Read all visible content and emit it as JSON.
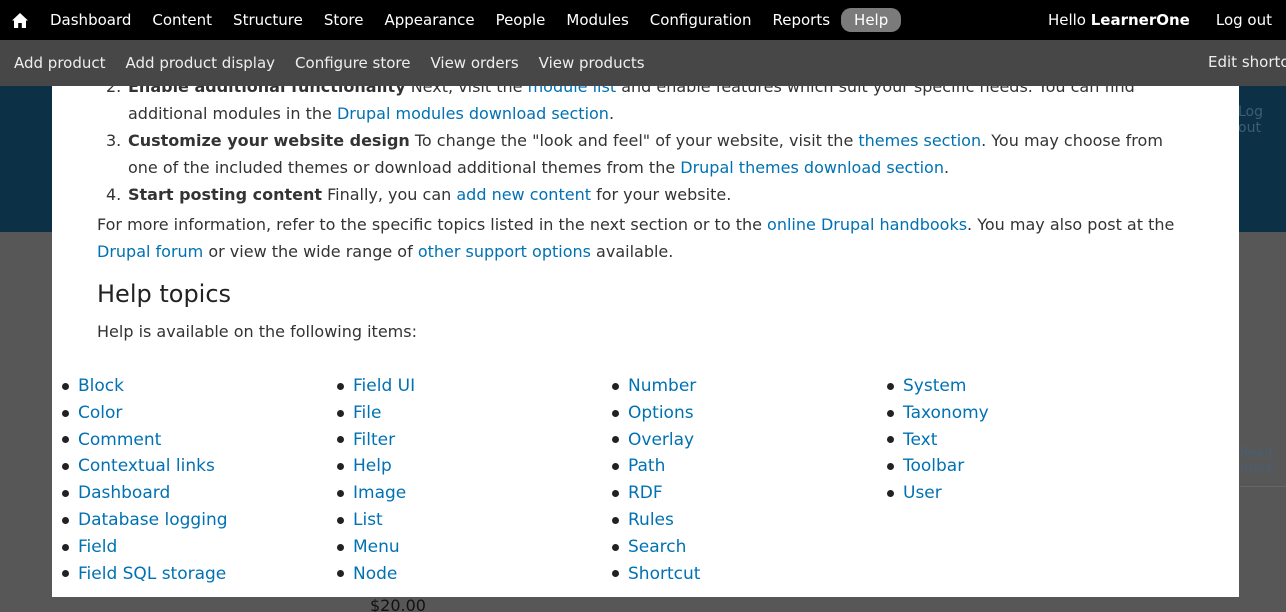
{
  "toolbar": {
    "home_label": "Home",
    "nav": [
      "Dashboard",
      "Content",
      "Structure",
      "Store",
      "Appearance",
      "People",
      "Modules",
      "Configuration",
      "Reports",
      "Help"
    ],
    "active": "Help",
    "hello_prefix": "Hello ",
    "username": "LearnerOne",
    "logout": "Log out"
  },
  "shortcuts": {
    "items": [
      "Add product",
      "Add product display",
      "Configure store",
      "View orders",
      "View products"
    ],
    "edit": "Edit shortcuts"
  },
  "background": {
    "logout": "Log out",
    "read_more": "Read more",
    "price": "$20.00"
  },
  "help": {
    "step2": {
      "num": "2.",
      "bold": "Enable additional functionality",
      "t1": " Next, visit the ",
      "l1": "module list",
      "t2": " and enable features which suit your specific needs. You can find additional modules in the ",
      "l2": "Drupal modules download section",
      "t3": "."
    },
    "step3": {
      "num": "3.",
      "bold": "Customize your website design",
      "t1": " To change the \"look and feel\" of your website, visit the ",
      "l1": "themes section",
      "t2": ". You may choose from one of the included themes or download additional themes from the ",
      "l2": "Drupal themes download section",
      "t3": "."
    },
    "step4": {
      "num": "4.",
      "bold": "Start posting content",
      "t1": " Finally, you can ",
      "l1": "add new content",
      "t2": " for your website."
    },
    "more": {
      "t1": "For more information, refer to the specific topics listed in the next section or to the ",
      "l1": "online Drupal handbooks",
      "t2": ". You may also post at the ",
      "l2": "Drupal forum",
      "t3": " or view the wide range of ",
      "l3": "other support options",
      "t4": " available."
    },
    "topics_title": "Help topics",
    "topics_intro": "Help is available on the following items:",
    "columns": [
      [
        "Block",
        "Color",
        "Comment",
        "Contextual links",
        "Dashboard",
        "Database logging",
        "Field",
        "Field SQL storage"
      ],
      [
        "Field UI",
        "File",
        "Filter",
        "Help",
        "Image",
        "List",
        "Menu",
        "Node"
      ],
      [
        "Number",
        "Options",
        "Overlay",
        "Path",
        "RDF",
        "Rules",
        "Search",
        "Shortcut"
      ],
      [
        "System",
        "Taxonomy",
        "Text",
        "Toolbar",
        "User"
      ]
    ]
  }
}
